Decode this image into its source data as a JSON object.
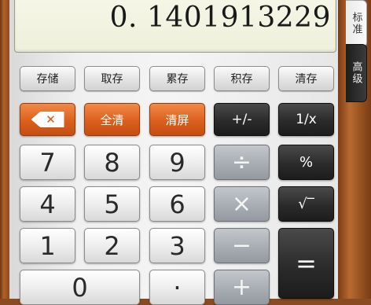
{
  "display": {
    "value": "0. 1401913229"
  },
  "tabs": {
    "standard": "标准",
    "advanced": "高级"
  },
  "memory": {
    "store": "存储",
    "recall": "取存",
    "add": "累存",
    "multiply": "积存",
    "clear": "清存"
  },
  "function_row": {
    "clear_all": "全清",
    "clear_screen": "清屏",
    "sign": "+/-",
    "reciprocal": "1/x"
  },
  "digits": {
    "d0": "0",
    "d1": "1",
    "d2": "2",
    "d3": "3",
    "d4": "4",
    "d5": "5",
    "d6": "6",
    "d7": "7",
    "d8": "8",
    "d9": "9",
    "dot": "·"
  },
  "operators": {
    "divide": "÷",
    "multiply": "×",
    "minus": "−",
    "plus": "+",
    "percent": "%",
    "sqrt": "√‾",
    "equals": "="
  },
  "icons": {
    "backspace": "backspace-icon"
  },
  "colors": {
    "orange": "#dc5f1c",
    "dark": "#2b2b2b",
    "operator_gray": "#a8adb3",
    "display_bg": "#f2f4e2"
  }
}
